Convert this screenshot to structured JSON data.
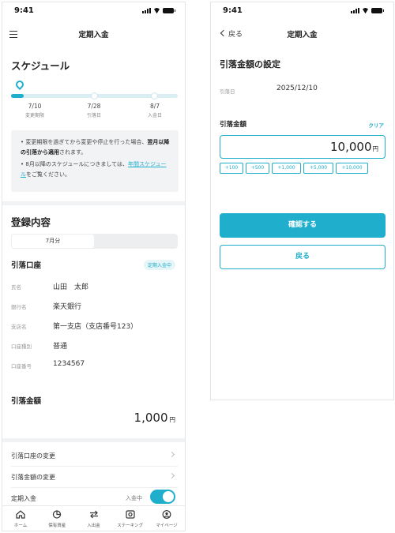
{
  "colors": {
    "accent": "#1faecc",
    "band": "#f0f2f4",
    "text": "#333333"
  },
  "status_bar": {
    "time": "9:41"
  },
  "screen1": {
    "title": "定期入金",
    "schedule": {
      "heading": "スケジュール",
      "milestones": [
        {
          "date": "7/10",
          "label": "変更期限"
        },
        {
          "date": "7/28",
          "label": "引落日"
        },
        {
          "date": "8/7",
          "label": "入金日"
        }
      ],
      "notice_line1": "変更期限を過ぎてから変更や停止を行った場合、",
      "notice_line1_bold": "翌月以降の引落から適用",
      "notice_line1_end": "されます。",
      "notice_line2": "8月以降のスケジュールにつきましては、",
      "notice_link": "年間スケジュール",
      "notice_line2_end": "をご覧ください。"
    },
    "registration": {
      "heading": "登録内容",
      "segment_active": "7月分",
      "account_heading": "引落口座",
      "badge": "定期入金中",
      "rows": [
        {
          "label": "氏名",
          "value": "山田　太郎"
        },
        {
          "label": "銀行名",
          "value": "楽天銀行"
        },
        {
          "label": "支店名",
          "value": "第一支店（支店番号123）"
        },
        {
          "label": "口座種別",
          "value": "普通"
        },
        {
          "label": "口座番号",
          "value": "1234567"
        }
      ],
      "amount_heading": "引落金額",
      "amount": "1,000",
      "yen": "円"
    },
    "menu": {
      "change_account": "引落口座の変更",
      "change_amount": "引落金額の変更",
      "periodic": "定期入金",
      "periodic_status": "入金中",
      "toggle_on": true
    },
    "tabbar": {
      "tabs": [
        {
          "label": "ホーム",
          "icon": "home-icon"
        },
        {
          "label": "保有資産",
          "icon": "pie-chart-icon"
        },
        {
          "label": "入出金",
          "icon": "transfer-icon"
        },
        {
          "label": "ステーキング",
          "icon": "staking-icon"
        },
        {
          "label": "マイページ",
          "icon": "user-icon"
        }
      ]
    }
  },
  "screen2": {
    "back_label": "戻る",
    "title": "定期入金",
    "section_heading": "引落金額の設定",
    "date_label": "引落日",
    "date_value": "2025/12/10",
    "amount_label": "引落金額",
    "clear_label": "クリア",
    "amount_value": "10,000",
    "yen": "円",
    "chips": [
      "+100",
      "+500",
      "+1,000",
      "+5,000",
      "+10,000"
    ],
    "confirm_button": "確認する",
    "back_button": "戻る"
  }
}
